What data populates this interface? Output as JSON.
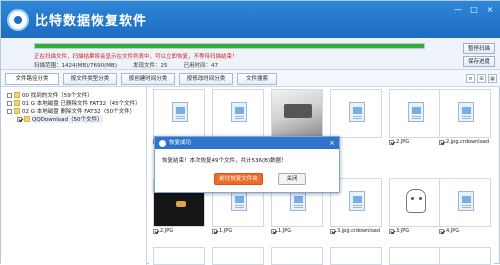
{
  "app": {
    "title": "比特数据恢复软件",
    "window_controls": [
      "—",
      "□",
      "×"
    ]
  },
  "status": {
    "progress": 1.0,
    "message": "正在扫描文件，扫描结果将会显示在文件列表中，可以立即恢复，不等待扫描结束！",
    "range": "扫描范围：1424(MB)/7690(MB)",
    "found": "发现文件：25",
    "elapsed": "已用时间：47"
  },
  "side_buttons": {
    "pause": "暂停扫描",
    "save": "保存进度"
  },
  "tabs": [
    "文件路径分类",
    "按文件类型分类",
    "按创建时间分类",
    "按修改时间分类",
    "文件搜索"
  ],
  "view_icons": [
    "≡",
    "⊞",
    "▦"
  ],
  "tree": [
    {
      "label": "00 找到的文件（59个文件）",
      "checked": false
    },
    {
      "label": "01 G 本地磁盘 已删除文件 FAT32（45个文件）",
      "checked": false
    },
    {
      "label": "02 G 本地磁盘 删除文件 FAT32（50个文件）",
      "checked": false
    },
    {
      "label": "QQDownload（50个文件）",
      "checked": true
    }
  ],
  "grid": [
    {
      "caption": "",
      "kind": "doc",
      "checked": true
    },
    {
      "caption": "",
      "kind": "doc",
      "checked": true
    },
    {
      "caption": "",
      "kind": "room",
      "checked": true
    },
    {
      "caption": "",
      "kind": "doc",
      "checked": true
    },
    {
      "caption": "2.JPG",
      "kind": "doc",
      "checked": true
    },
    {
      "caption": "2.jpg.crdownload",
      "kind": "doc",
      "checked": true
    },
    {
      "caption": "2.JPG",
      "kind": "dark",
      "checked": true
    },
    {
      "caption": "1.JPG",
      "kind": "doc",
      "checked": true
    },
    {
      "caption": "1.JPG",
      "kind": "doc",
      "checked": true
    },
    {
      "caption": "3.jpg.crdownload",
      "kind": "doc",
      "checked": true
    },
    {
      "caption": "3.JPG",
      "kind": "cat",
      "checked": true
    },
    {
      "caption": "4.JPG",
      "kind": "doc",
      "checked": true
    }
  ],
  "dialog": {
    "title": "恢复成功",
    "close": "×",
    "message": "恢复结束！本次恢复49个文件，共计536(B)数据！",
    "open_button": "前往恢复文件夹",
    "close_button": "关闭"
  }
}
